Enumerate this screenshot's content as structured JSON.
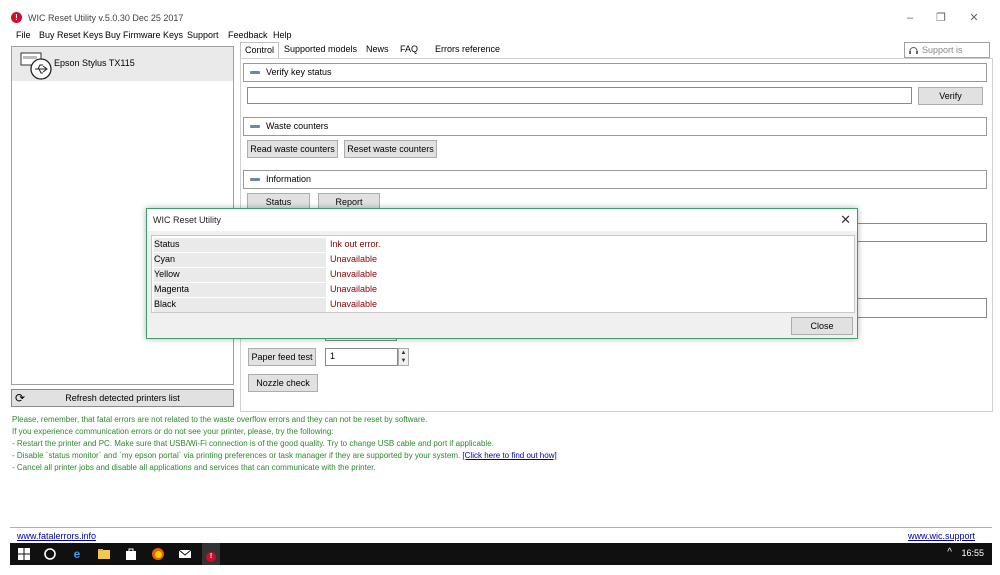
{
  "window": {
    "title": "WIC Reset Utility v.5.0.30 Dec 25 2017",
    "minimize": "–",
    "maximize": "❐",
    "close": "✕"
  },
  "menu": [
    "File",
    "Buy Reset Keys",
    "Buy Firmware Keys",
    "Support",
    "Feedback",
    "Help"
  ],
  "printers": {
    "selected": "Epson Stylus TX115",
    "refresh_label": "Refresh detected printers list"
  },
  "tabs": [
    "Control",
    "Supported models",
    "News",
    "FAQ",
    "Errors reference"
  ],
  "support_status": "Support is Offline",
  "sections": {
    "verify": {
      "label": "Verify key status",
      "input_value": "",
      "button": "Verify"
    },
    "waste": {
      "label": "Waste counters",
      "read_button": "Read waste counters",
      "reset_button": "Reset waste counters"
    },
    "information": {
      "label": "Information",
      "status_button": "Status",
      "report_button": "Report"
    }
  },
  "tests": {
    "paper_feed_label": "Paper feed test",
    "paper_feed_value": "1",
    "nozzle_label": "Nozzle check"
  },
  "hints": {
    "line1": "Please, remember, that fatal errors are not related to the waste overflow errors and they can not be reset by software.",
    "line2": "If you experience communication errors or do not see your printer, please, try the following:",
    "line3": "- Restart the printer and PC. Make sure that USB/Wi-Fi connection is of the good quality. Try to change USB cable and port if applicable.",
    "line4_prefix": "- Disable `status monitor` and `my epson portal` via printing preferences or task manager if they are supported by your system. ",
    "line4_link": "[Click here to find out how]",
    "line5": "- Cancel all printer jobs and disable all applications and services that can communicate with the printer."
  },
  "footer": {
    "left_link": "www.fatalerrors.info",
    "right_link": "www.wic.support"
  },
  "taskbar": {
    "time": "16:55",
    "caret": "^"
  },
  "dialog": {
    "title": "WIC Reset Utility",
    "rows": [
      {
        "key": "Status",
        "value": "Ink out error."
      },
      {
        "key": "Cyan",
        "value": "Unavailable"
      },
      {
        "key": "Yellow",
        "value": "Unavailable"
      },
      {
        "key": "Magenta",
        "value": "Unavailable"
      },
      {
        "key": "Black",
        "value": "Unavailable"
      }
    ],
    "close_button": "Close",
    "close_x": "✕"
  },
  "colors": {
    "accent_green": "#3aa06a",
    "hint_green": "#2b8a2b",
    "error_red": "#8b0000",
    "link_blue": "#0000aa"
  },
  "icons": [
    "app-warning-icon",
    "printer-usb-icon",
    "refresh-icon",
    "headset-icon",
    "windows-start-icon",
    "cortana-icon",
    "edge-icon",
    "file-explorer-icon",
    "store-icon",
    "firefox-icon",
    "mail-icon",
    "wic-app-icon"
  ]
}
